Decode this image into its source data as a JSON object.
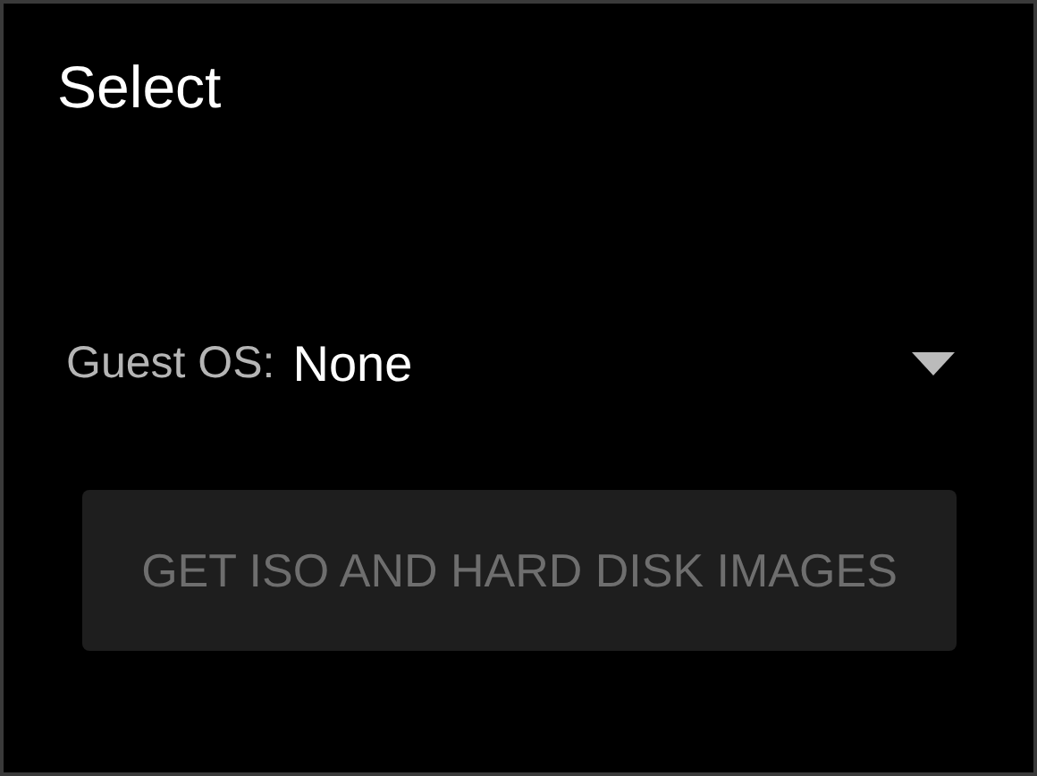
{
  "dialog": {
    "title": "Select"
  },
  "guest_os": {
    "label": "Guest OS:",
    "value": "None"
  },
  "button": {
    "label": "GET ISO AND HARD DISK IMAGES",
    "disabled": true
  }
}
